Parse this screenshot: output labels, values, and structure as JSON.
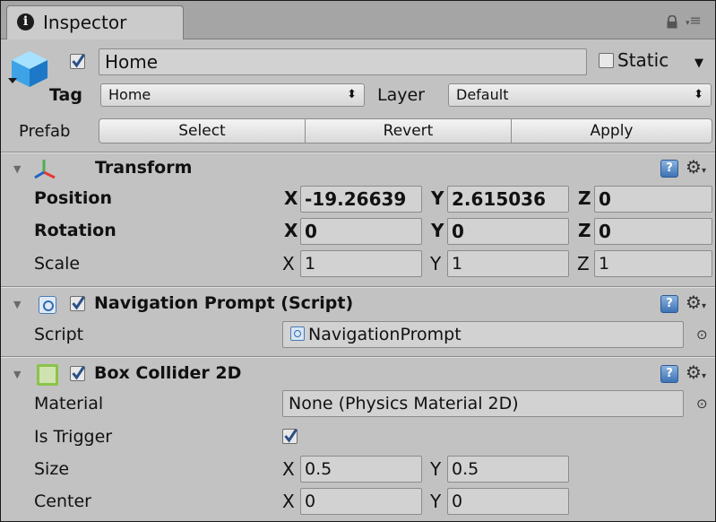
{
  "tab": {
    "title": "Inspector"
  },
  "header": {
    "active": true,
    "name": "Home",
    "static_label": "Static",
    "static_checked": false,
    "tag_label": "Tag",
    "tag_value": "Home",
    "layer_label": "Layer",
    "layer_value": "Default"
  },
  "prefab": {
    "label": "Prefab",
    "select_label": "Select",
    "revert_label": "Revert",
    "apply_label": "Apply"
  },
  "transform": {
    "title": "Transform",
    "position": {
      "label": "Position",
      "x": "-19.26639",
      "y": "2.615036",
      "z": "0"
    },
    "rotation": {
      "label": "Rotation",
      "x": "0",
      "y": "0",
      "z": "0"
    },
    "scale": {
      "label": "Scale",
      "x": "1",
      "y": "1",
      "z": "1"
    },
    "axis": {
      "x": "X",
      "y": "Y",
      "z": "Z"
    }
  },
  "navigation_prompt": {
    "title": "Navigation Prompt (Script)",
    "enabled": true,
    "script_label": "Script",
    "script_value": "NavigationPrompt"
  },
  "box_collider": {
    "title": "Box Collider 2D",
    "enabled": true,
    "material_label": "Material",
    "material_value": "None (Physics Material 2D)",
    "is_trigger_label": "Is Trigger",
    "is_trigger": true,
    "size_label": "Size",
    "size_x": "0.5",
    "size_y": "0.5",
    "center_label": "Center",
    "center_x": "0",
    "center_y": "0"
  },
  "icons": {
    "info": "i",
    "help": "?",
    "gear": "⚙",
    "target": "⊙",
    "fold": "▼",
    "popup_arrows": "⬍",
    "lock": "🔒",
    "menu": "≡"
  },
  "colors": {
    "panel": "#c2c2c2",
    "tabbar": "#a5a5a5",
    "field": "#d2d2d2",
    "check_mark": "#2b4f86"
  }
}
